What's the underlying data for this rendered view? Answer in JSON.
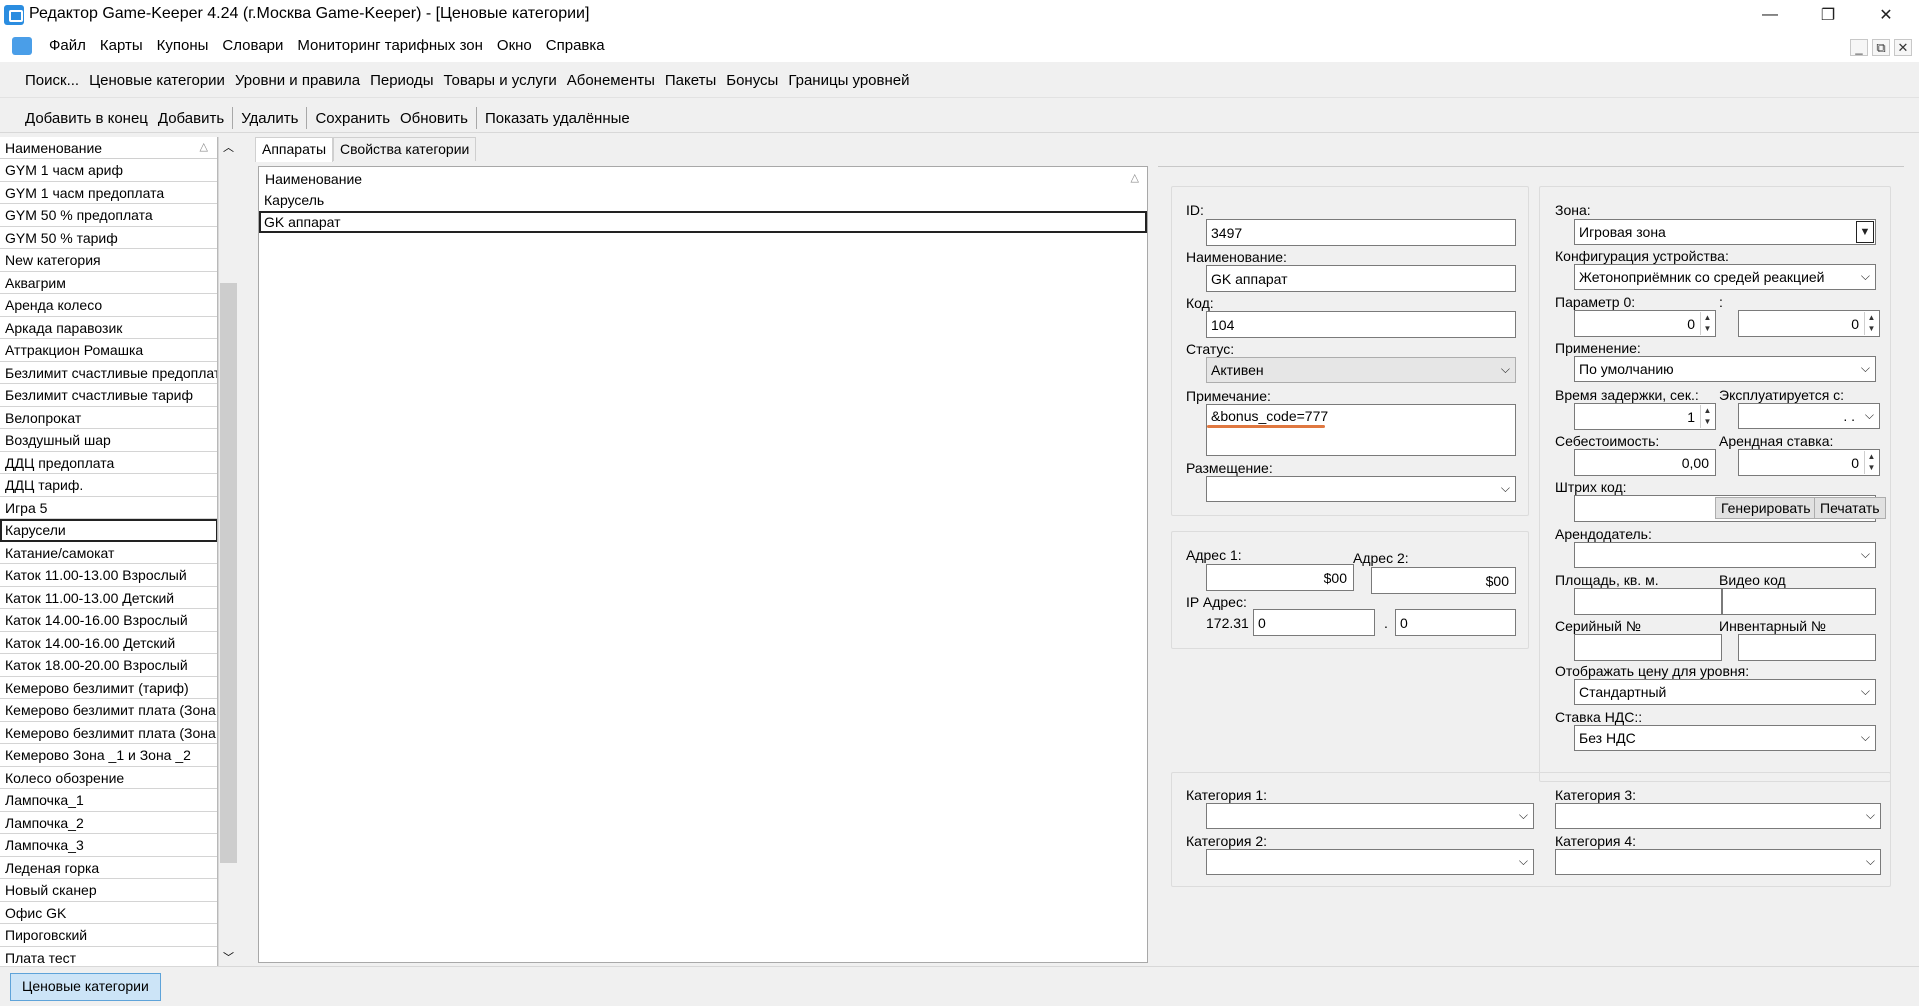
{
  "window": {
    "title": "Редактор Game-Keeper 4.24 (г.Москва Game-Keeper) - [Ценовые категории]",
    "minimize": "—",
    "maximize": "❐",
    "close": "✕"
  },
  "menu": [
    "Файл",
    "Карты",
    "Купоны",
    "Словари",
    "Мониторинг тарифных зон",
    "Окно",
    "Справка"
  ],
  "mdi_controls": {
    "minimize": "_",
    "restore": "⧉",
    "close": "✕"
  },
  "nav": [
    "Поиск...",
    "Ценовые категории",
    "Уровни и правила",
    "Периоды",
    "Товары и услуги",
    "Абонементы",
    "Пакеты",
    "Бонусы",
    "Границы уровней"
  ],
  "actions": [
    "Добавить в конец",
    "Добавить",
    "Удалить",
    "Сохранить",
    "Обновить",
    "Показать удалённые"
  ],
  "left_list": {
    "header": "Наименование",
    "sort_icon": "sort-ascending-icon",
    "items": [
      "GYM 1 часм ариф",
      "GYM 1 часм предоплата",
      "GYM 50 % предоплата",
      "GYM 50 % тариф",
      "New категория",
      "Аквагрим",
      "Аренда колесо",
      "Аркада паравозик",
      "Аттракцион Ромашка",
      "Безлимит счастливые предоплат",
      "Безлимит счастливые тариф",
      "Велопрокат",
      "Воздушный шар",
      "ДДЦ предоплата",
      "ДДЦ тариф.",
      "Игра 5",
      "Карусели",
      "Катание/самокат",
      "Каток 11.00-13.00 Взрослый",
      "Каток 11.00-13.00 Детский",
      "Каток 14.00-16.00 Взрослый",
      "Каток 14.00-16.00 Детский",
      "Каток 18.00-20.00 Взрослый",
      "Кемерово безлимит (тариф)",
      "Кемерово безлимит плата (Зона",
      "Кемерово безлимит плата (Зона",
      "Кемерово Зона _1 и Зона _2",
      "Колесо обозрение",
      "Лампочка_1",
      "Лампочка_2",
      "Лампочка_3",
      "Леденая горка",
      "Новый сканер",
      "Офис GK",
      "Пироговский",
      "Плата тест"
    ],
    "selected_index": 16
  },
  "tabs": [
    "Аппараты",
    "Свойства категории"
  ],
  "machines": {
    "header": "Наименование",
    "items": [
      "Карусель",
      "GK аппарат"
    ],
    "selected_index": 1
  },
  "details": {
    "id_label": "ID:",
    "id_value": "3497",
    "name_label": "Наименование:",
    "name_value": "GK аппарат",
    "code_label": "Код:",
    "code_value": "104",
    "status_label": "Статус:",
    "status_value": "Активен",
    "note_label": "Примечание:",
    "note_value": "&bonus_code=777",
    "placement_label": "Размещение:",
    "placement_value": "",
    "addr1_label": "Адрес 1:",
    "addr1_value": "$00",
    "addr2_label": "Адрес 2:",
    "addr2_value": "$00",
    "ip_label": "IP Адрес:",
    "ip_prefix": "172.31",
    "ip_part3": "0",
    "ip_dot": ".",
    "ip_part4": "0",
    "zone_label": "Зона:",
    "zone_value": "Игровая зона",
    "config_label": "Конфигурация устройства:",
    "config_value": "Жетоноприёмник со средей реакцией",
    "param0_label": "Параметр 0:",
    "param0_value": "0",
    "param_colon": ":",
    "param1_value": "0",
    "apply_label": "Применение:",
    "apply_value": "По умолчанию",
    "delay_label": "Время задержки, сек.:",
    "delay_value": "1",
    "exploited_label": "Эксплуатируется с:",
    "exploited_value": " .  .",
    "cost_label": "Себестоимость:",
    "cost_value": "0,00",
    "rent_label": "Арендная ставка:",
    "rent_value": "0",
    "barcode_label": "Штрих код:",
    "barcode_value": "",
    "generate_button": "Генерировать",
    "print_button": "Печатать",
    "landlord_label": "Арендодатель:",
    "landlord_value": "",
    "area_label": "Площадь, кв. м.",
    "area_value": "",
    "video_label": "Видео код",
    "video_value": "",
    "serial_label": "Серийный №",
    "serial_value": "",
    "inventory_label": "Инвентарный №",
    "inventory_value": "",
    "price_level_label": "Отображать цену для уровня:",
    "price_level_value": "Стандартный",
    "vat_label": "Ставка НДС::",
    "vat_value": "Без НДС",
    "cat1_label": "Категория 1:",
    "cat2_label": "Категория 2:",
    "cat3_label": "Категория 3:",
    "cat4_label": "Категория 4:"
  },
  "bottom_tab": "Ценовые категории",
  "colors": {
    "accent": "#2b8de0",
    "highlight_underline": "#e07840",
    "bottom_tab_bg": "#cce4f7"
  }
}
